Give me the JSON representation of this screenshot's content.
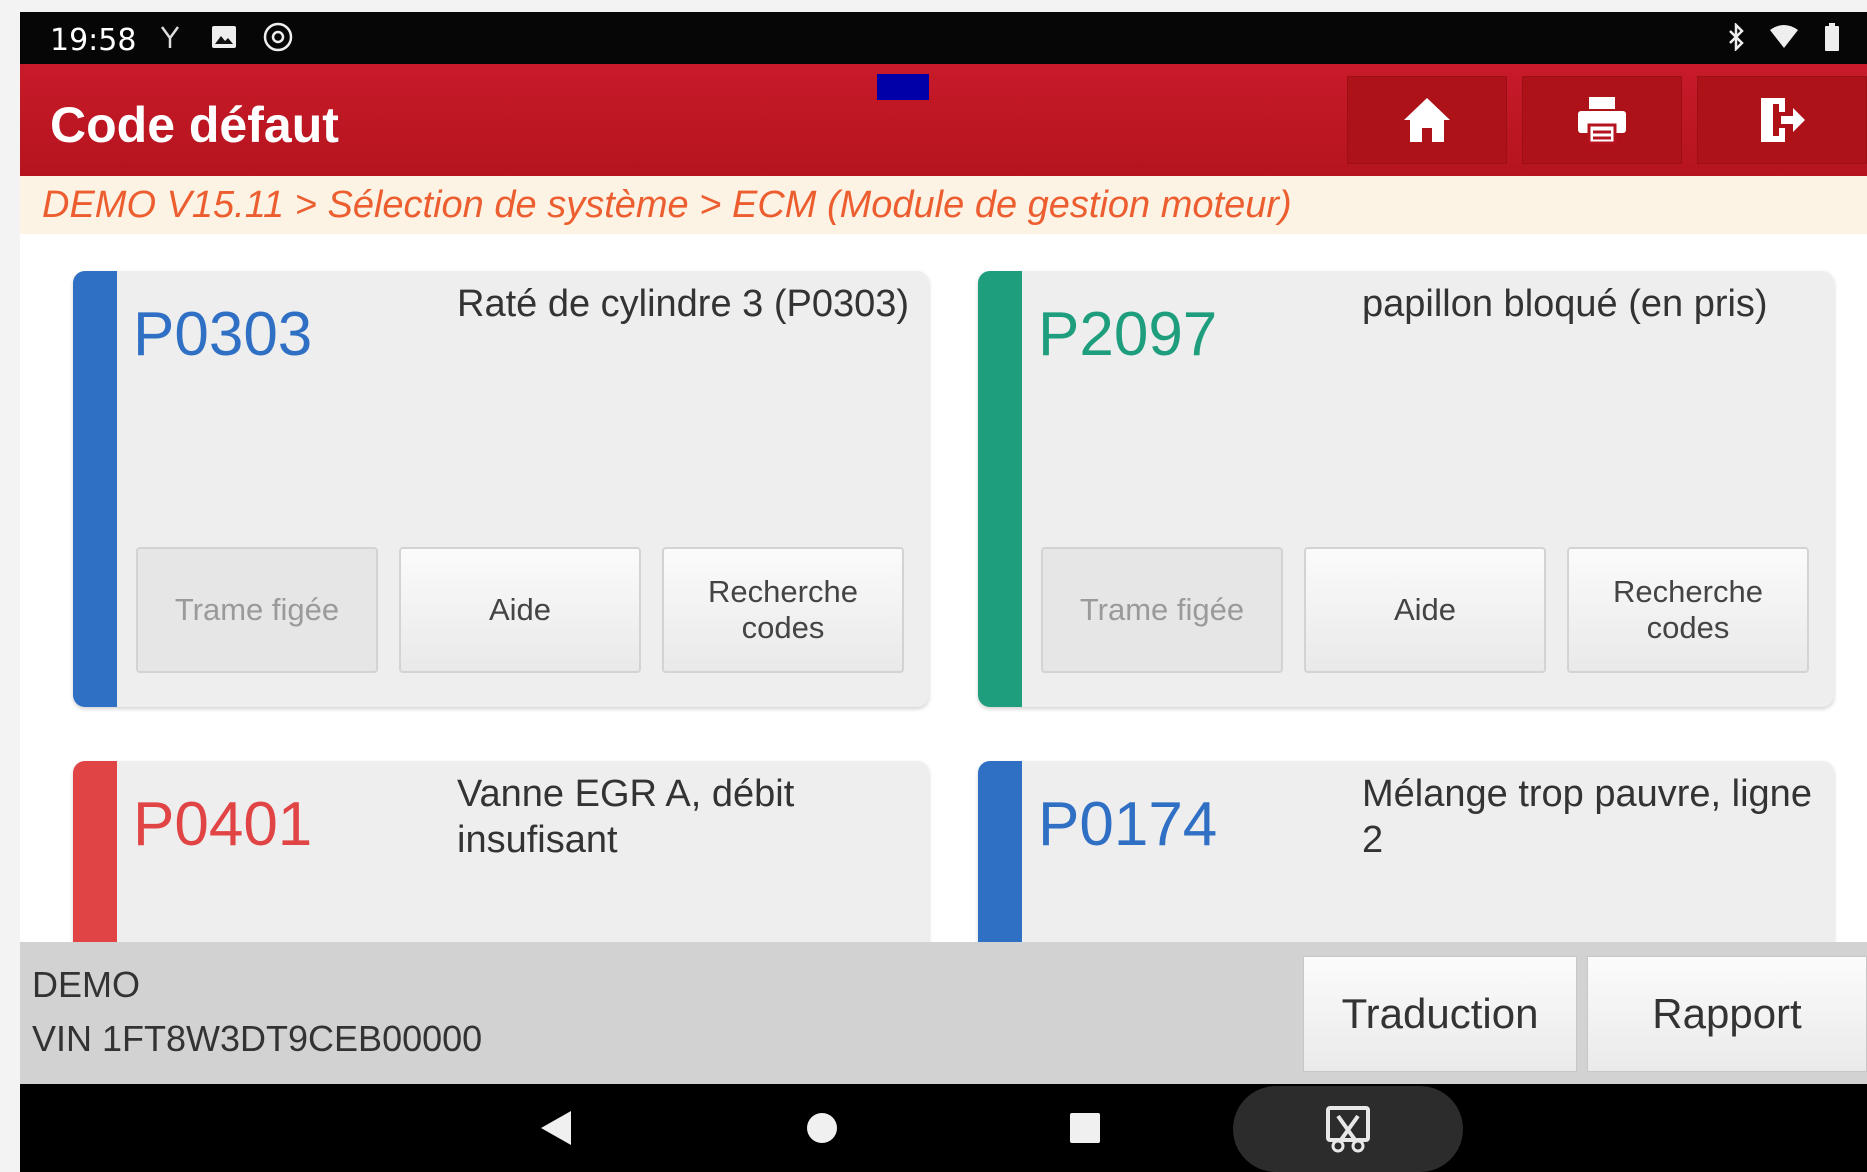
{
  "status_bar": {
    "time": "19:58",
    "left_icons": [
      "usb-icon",
      "image-icon",
      "settings-circle-icon"
    ],
    "right_icons": [
      "bluetooth-icon",
      "wifi-icon",
      "battery-icon"
    ]
  },
  "header": {
    "title": "Code défaut",
    "buttons": [
      "home-icon",
      "print-icon",
      "exit-icon"
    ]
  },
  "breadcrumb": "DEMO V15.11 > Sélection de système > ECM (Module de gestion moteur)",
  "cards": [
    {
      "code": "P0303",
      "description": "Raté de cylindre 3 (P0303)",
      "color": "#2f6fc4",
      "buttons": {
        "freeze": "Trame figée",
        "help": "Aide",
        "search": "Recherche codes"
      }
    },
    {
      "code": "P2097",
      "description": "papillon bloqué (en pris)",
      "color": "#1f9e7d",
      "buttons": {
        "freeze": "Trame figée",
        "help": "Aide",
        "search": "Recherche codes"
      }
    },
    {
      "code": "P0401",
      "description": "Vanne EGR A, débit insufisant",
      "color": "#e14444"
    },
    {
      "code": "P0174",
      "description": "Mélange trop pauvre, ligne 2",
      "color": "#2f6fc4"
    }
  ],
  "info": {
    "label": "DEMO",
    "vin": "VIN 1FT8W3DT9CEB00000",
    "translate_button": "Traduction",
    "report_button": "Rapport"
  },
  "nav": [
    "back-icon",
    "home-circle-icon",
    "recents-icon",
    "screenshot-crop-icon"
  ],
  "colors": {
    "accent_red": "#b8151f",
    "breadcrumb_text": "#ec5e30"
  }
}
